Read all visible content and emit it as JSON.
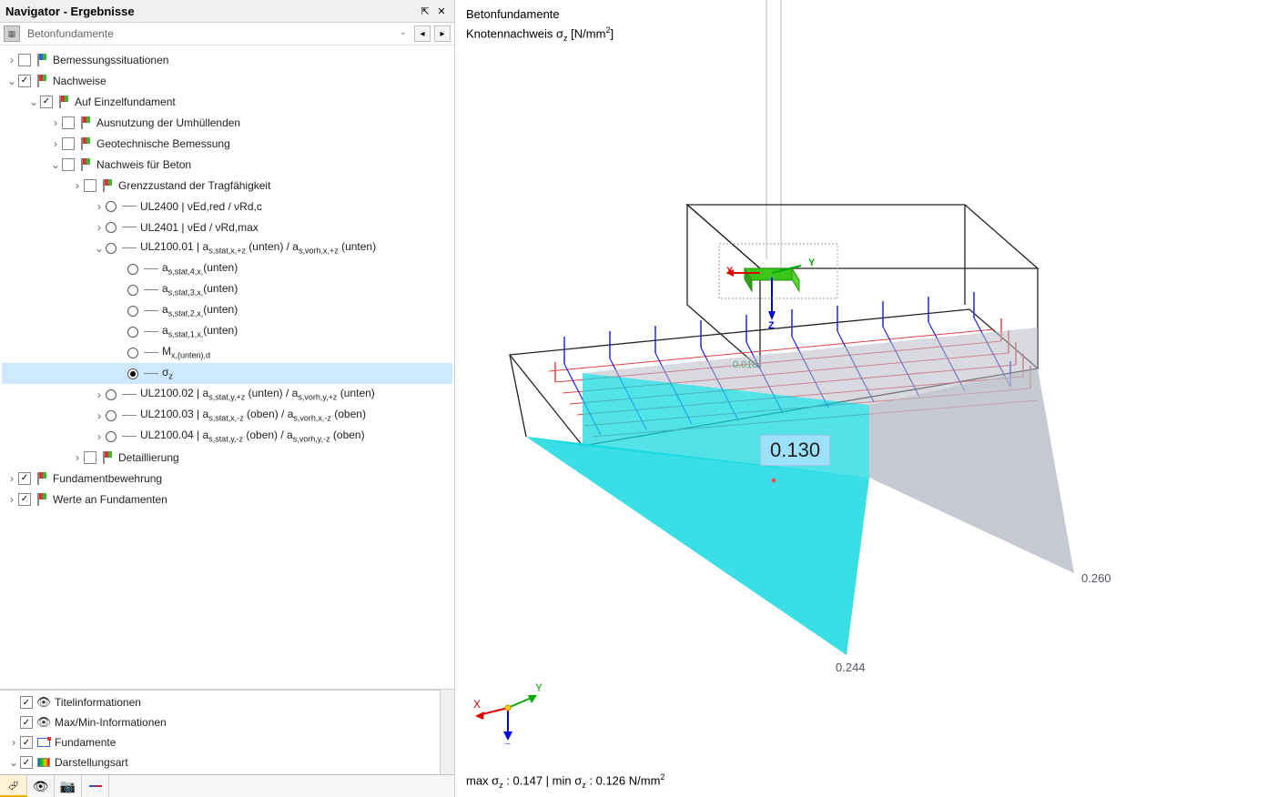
{
  "navigator": {
    "title": "Navigator - Ergebnisse",
    "dropdown": "Betonfundamente"
  },
  "tree": {
    "bemessung": "Bemessungssituationen",
    "nachweise": "Nachweise",
    "aufEinzel": "Auf Einzelfundament",
    "ausnutzung": "Ausnutzung der Umhüllenden",
    "geotech": "Geotechnische Bemessung",
    "nachweisBeton": "Nachweis für Beton",
    "grenz": "Grenzzustand der Tragfähigkeit",
    "ul2400": "UL2400 | νEd,red / νRd,c",
    "ul2401": "UL2401 | νEd / νRd,max",
    "ul210001_html": "UL2100.01 | a<span class='sub'>s,stat,x,+z</span> (unten) / a<span class='sub'>s,vorh,x,+z</span> (unten)",
    "as4": "a<span class='sub'>s,stat,4,x,</span>(unten)",
    "as3": "a<span class='sub'>s,stat,3,x,</span>(unten)",
    "as2": "a<span class='sub'>s,stat,2,x,</span>(unten)",
    "as1": "a<span class='sub'>s,stat,1,x,</span>(unten)",
    "mx": "M<span class='sub'>x,(unten),d</span>",
    "sigmaz": "σ<span class='sub'>z</span>",
    "ul210002_html": "UL2100.02 | a<span class='sub'>s,stat,y,+z</span> (unten) / a<span class='sub'>s,vorh,y,+z</span> (unten)",
    "ul210003_html": "UL2100.03 | a<span class='sub'>s,stat,x,-z</span> (oben) / a<span class='sub'>s,vorh,x,-z</span> (oben)",
    "ul210004_html": "UL2100.04 | a<span class='sub'>s,stat,y,-z</span> (oben) / a<span class='sub'>s,vorh,y,-z</span> (oben)",
    "detail": "Detaillierung",
    "fundBew": "Fundamentbewehrung",
    "werte": "Werte an Fundamenten"
  },
  "bottom": {
    "titel": "Titelinformationen",
    "maxmin": "Max/Min-Informationen",
    "funda": "Fundamente",
    "darst": "Darstellungsart"
  },
  "viewport": {
    "title": "Betonfundamente",
    "subtitle_html": "Knotennachweis σ<span class='sub'>z</span> [N/mm<sup style='font-size:9px'>2</sup>]",
    "value_main": "0.130",
    "value_018": "0.018",
    "value_260": "0.260",
    "value_244": "0.244",
    "status_html": "max σ<span class='sub'>z</span> : 0.147 | min σ<span class='sub'>z</span> : 0.126 N/mm<sup style='font-size:9px'>2</sup>",
    "axis_x": "X",
    "axis_y": "Y",
    "axis_z": "Z"
  }
}
